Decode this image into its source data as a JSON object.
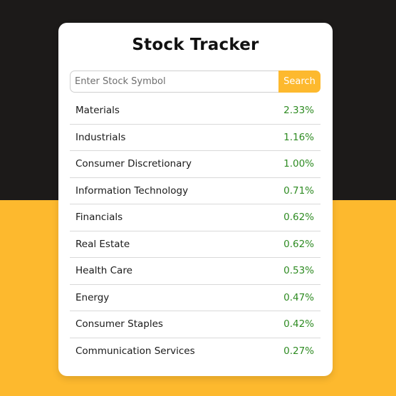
{
  "colors": {
    "top_background": "#1c1a19",
    "bottom_background": "#fdb92e",
    "accent": "#fdb92e",
    "positive": "#2e8b22"
  },
  "header": {
    "title": "Stock Tracker"
  },
  "search": {
    "placeholder": "Enter Stock Symbol",
    "value": "",
    "button_label": "Search"
  },
  "sectors": [
    {
      "name": "Materials",
      "change": "2.33%"
    },
    {
      "name": "Industrials",
      "change": "1.16%"
    },
    {
      "name": "Consumer Discretionary",
      "change": "1.00%"
    },
    {
      "name": "Information Technology",
      "change": "0.71%"
    },
    {
      "name": "Financials",
      "change": "0.62%"
    },
    {
      "name": "Real Estate",
      "change": "0.62%"
    },
    {
      "name": "Health Care",
      "change": "0.53%"
    },
    {
      "name": "Energy",
      "change": "0.47%"
    },
    {
      "name": "Consumer Staples",
      "change": "0.42%"
    },
    {
      "name": "Communication Services",
      "change": "0.27%"
    }
  ]
}
